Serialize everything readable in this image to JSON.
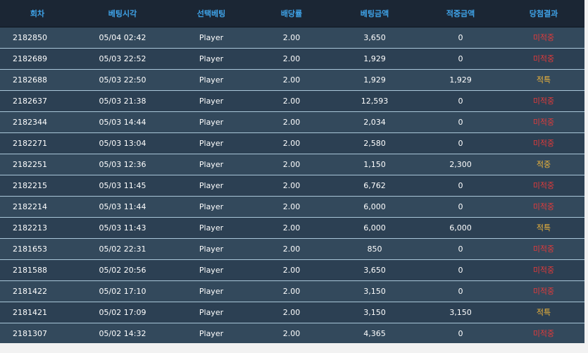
{
  "table": {
    "headers": [
      "회차",
      "베팅시각",
      "선택베팅",
      "배당률",
      "베팅금액",
      "적중금액",
      "당첨결과"
    ],
    "rows": [
      {
        "round": "2182850",
        "time": "05/04 02:42",
        "pick": "Player",
        "odds": "2.00",
        "bet": "3,650",
        "win": "0",
        "result": "미적중",
        "status": "lose"
      },
      {
        "round": "2182689",
        "time": "05/03 22:52",
        "pick": "Player",
        "odds": "2.00",
        "bet": "1,929",
        "win": "0",
        "result": "미적중",
        "status": "lose"
      },
      {
        "round": "2182688",
        "time": "05/03 22:50",
        "pick": "Player",
        "odds": "2.00",
        "bet": "1,929",
        "win": "1,929",
        "result": "적특",
        "status": "win"
      },
      {
        "round": "2182637",
        "time": "05/03 21:38",
        "pick": "Player",
        "odds": "2.00",
        "bet": "12,593",
        "win": "0",
        "result": "미적중",
        "status": "lose"
      },
      {
        "round": "2182344",
        "time": "05/03 14:44",
        "pick": "Player",
        "odds": "2.00",
        "bet": "2,034",
        "win": "0",
        "result": "미적중",
        "status": "lose"
      },
      {
        "round": "2182271",
        "time": "05/03 13:04",
        "pick": "Player",
        "odds": "2.00",
        "bet": "2,580",
        "win": "0",
        "result": "미적중",
        "status": "lose"
      },
      {
        "round": "2182251",
        "time": "05/03 12:36",
        "pick": "Player",
        "odds": "2.00",
        "bet": "1,150",
        "win": "2,300",
        "result": "적중",
        "status": "win"
      },
      {
        "round": "2182215",
        "time": "05/03 11:45",
        "pick": "Player",
        "odds": "2.00",
        "bet": "6,762",
        "win": "0",
        "result": "미적중",
        "status": "lose"
      },
      {
        "round": "2182214",
        "time": "05/03 11:44",
        "pick": "Player",
        "odds": "2.00",
        "bet": "6,000",
        "win": "0",
        "result": "미적중",
        "status": "lose"
      },
      {
        "round": "2182213",
        "time": "05/03 11:43",
        "pick": "Player",
        "odds": "2.00",
        "bet": "6,000",
        "win": "6,000",
        "result": "적특",
        "status": "win"
      },
      {
        "round": "2181653",
        "time": "05/02 22:31",
        "pick": "Player",
        "odds": "2.00",
        "bet": "850",
        "win": "0",
        "result": "미적중",
        "status": "lose"
      },
      {
        "round": "2181588",
        "time": "05/02 20:56",
        "pick": "Player",
        "odds": "2.00",
        "bet": "3,650",
        "win": "0",
        "result": "미적중",
        "status": "lose"
      },
      {
        "round": "2181422",
        "time": "05/02 17:10",
        "pick": "Player",
        "odds": "2.00",
        "bet": "3,150",
        "win": "0",
        "result": "미적중",
        "status": "lose"
      },
      {
        "round": "2181421",
        "time": "05/02 17:09",
        "pick": "Player",
        "odds": "2.00",
        "bet": "3,150",
        "win": "3,150",
        "result": "적특",
        "status": "win"
      },
      {
        "round": "2181307",
        "time": "05/02 14:32",
        "pick": "Player",
        "odds": "2.00",
        "bet": "4,365",
        "win": "0",
        "result": "미적중",
        "status": "lose"
      }
    ]
  },
  "colors": {
    "header_text": "#3fa3e8",
    "lose": "#e23a3a",
    "win": "#f0b53a",
    "row_odd": "#33495c",
    "row_even": "#2c4053"
  }
}
